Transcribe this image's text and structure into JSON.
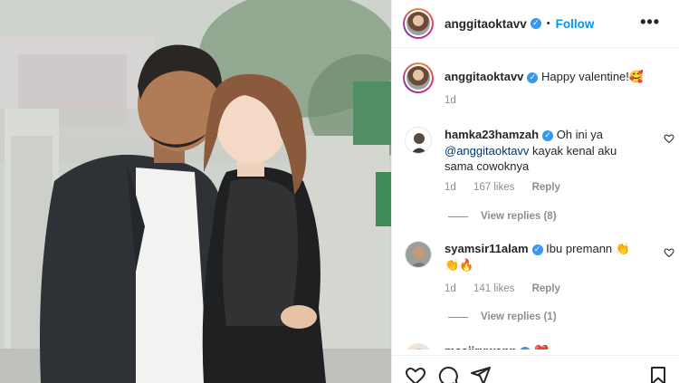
{
  "header": {
    "username": "anggitaoktavv",
    "dot": "•",
    "follow_label": "Follow",
    "more_label": "•••"
  },
  "caption": {
    "username": "anggitaoktavv",
    "text": "Happy valentine!🥰",
    "time": "1d"
  },
  "comments": [
    {
      "username": "hamka23hamzah",
      "text_before": "Oh ini ya ",
      "mention": "@anggitaoktavv",
      "text_after": " kayak kenal aku sama cowoknya",
      "time": "1d",
      "likes": "167 likes",
      "reply_label": "Reply",
      "view_replies": "View replies (8)"
    },
    {
      "username": "syamsir11alam",
      "text_before": "Ibu premann 👏",
      "mention": "",
      "text_after": " 👏🔥",
      "time": "1d",
      "likes": "141 likes",
      "reply_label": "Reply",
      "view_replies": "View replies (1)"
    },
    {
      "username": "maajiruwann",
      "text_before": "❤️",
      "mention": "",
      "text_after": ""
    }
  ],
  "icons": {
    "verified": "verified-badge-icon",
    "like": "heart-icon",
    "comment": "comment-icon",
    "share": "share-icon",
    "save": "bookmark-icon",
    "more": "more-options-icon"
  },
  "colors": {
    "accent": "#0095f6",
    "verified": "#3897f0",
    "muted": "#8e8e8e"
  }
}
